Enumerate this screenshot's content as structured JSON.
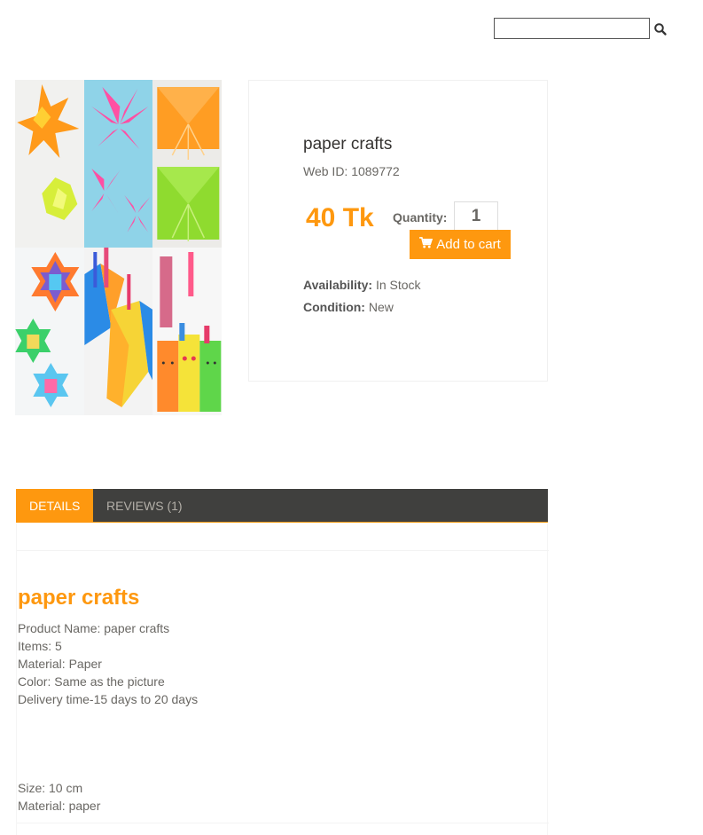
{
  "search": {
    "placeholder": ""
  },
  "icons": {
    "search": "search-icon",
    "cart": "shopping-cart-icon"
  },
  "colors": {
    "accent": "#FE980F",
    "tab_bar": "#40403e"
  },
  "product": {
    "name": "paper crafts",
    "web_id": "Web ID: 1089772",
    "price": "40 Tk",
    "quantity_label": "Quantity:",
    "quantity_value": "1",
    "add_to_cart": "Add to cart",
    "availability_label": "Availability:",
    "availability_value": "In Stock",
    "condition_label": "Condition:",
    "condition_value": "New"
  },
  "tabs": [
    {
      "label": "DETAILS",
      "active": true
    },
    {
      "label": "REVIEWS (1)",
      "active": false
    }
  ],
  "details": {
    "title": "paper crafts",
    "lines": [
      "Product Name: paper crafts",
      "Items: 5",
      "Material: Paper",
      "Color: Same as the picture",
      "Delivery time-15 days to 20 days"
    ],
    "lines2": [
      "Size: 10 cm",
      "Material: paper"
    ]
  }
}
